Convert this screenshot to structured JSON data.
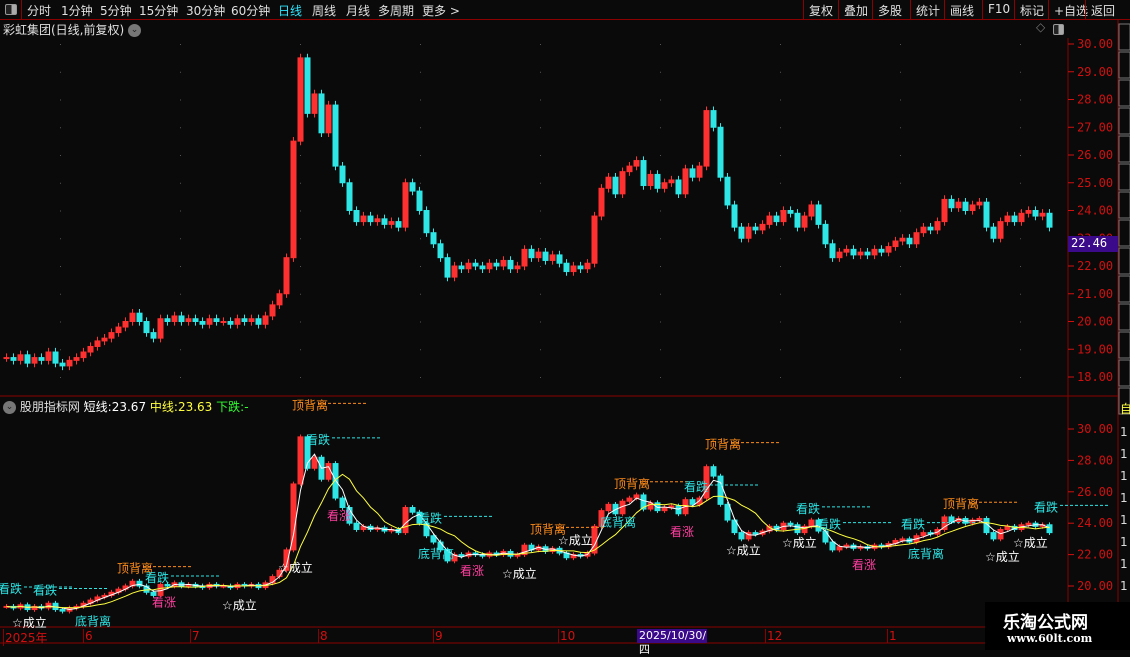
{
  "toolbar": {
    "periods": [
      {
        "label": "分时",
        "active": false
      },
      {
        "label": "1分钟",
        "active": false
      },
      {
        "label": "5分钟",
        "active": false
      },
      {
        "label": "15分钟",
        "active": false
      },
      {
        "label": "30分钟",
        "active": false
      },
      {
        "label": "60分钟",
        "active": false
      },
      {
        "label": "日线",
        "active": true
      },
      {
        "label": "周线",
        "active": false
      },
      {
        "label": "月线",
        "active": false
      },
      {
        "label": "多周期",
        "active": false
      },
      {
        "label": "更多 >",
        "active": false
      }
    ],
    "actions": [
      "复权",
      "叠加",
      "多股",
      "统计",
      "画线",
      "F10",
      "标记",
      "+自选",
      "返回"
    ]
  },
  "main": {
    "title": "彩虹集团(日线,前复权)",
    "last_price": "22.46",
    "last_price_bg": "#3a0a8a"
  },
  "indicator": {
    "name": "股朋指标网",
    "short_label": "短线:",
    "short_value": "23.67",
    "mid_label": "中线:",
    "mid_value": "23.63",
    "down_label": "下跌:",
    "down_value": "-",
    "right_tag": "自"
  },
  "watermark": {
    "title": "乐淘公式网",
    "url": "www.60lt.com"
  },
  "date_axis": {
    "labels": [
      "2025年",
      "6",
      "7",
      "8",
      "9",
      "10",
      "12",
      "1"
    ],
    "cursor_date": "2025/10/30/四"
  },
  "chart_data": [
    {
      "type": "candlestick",
      "panel": "main",
      "ylim": [
        17.6,
        30.2
      ],
      "yticks": [
        18,
        19,
        20,
        21,
        22,
        23,
        24,
        25,
        26,
        27,
        28,
        29,
        30
      ],
      "up_color": "#ff3030",
      "down_color": "#2ee6e6",
      "closes": [
        18.7,
        18.6,
        18.8,
        18.5,
        18.7,
        18.6,
        18.9,
        18.5,
        18.4,
        18.6,
        18.7,
        18.9,
        19.1,
        19.3,
        19.4,
        19.6,
        19.8,
        20.0,
        20.3,
        20.0,
        19.6,
        19.4,
        20.1,
        20.0,
        20.2,
        20.0,
        20.1,
        20.0,
        19.9,
        20.1,
        20.0,
        20.0,
        19.9,
        20.1,
        20.0,
        20.1,
        19.9,
        20.2,
        20.6,
        21.0,
        22.3,
        26.5,
        29.5,
        27.5,
        28.2,
        26.8,
        27.8,
        25.6,
        25.0,
        24.0,
        23.6,
        23.8,
        23.6,
        23.7,
        23.5,
        23.6,
        23.4,
        25.0,
        24.7,
        24.0,
        23.2,
        22.8,
        22.3,
        21.6,
        22.0,
        21.9,
        22.1,
        22.0,
        21.9,
        22.1,
        22.0,
        22.2,
        21.9,
        22.0,
        22.6,
        22.3,
        22.5,
        22.2,
        22.4,
        22.1,
        21.8,
        22.0,
        21.9,
        22.1,
        23.8,
        24.8,
        25.2,
        24.6,
        25.4,
        25.6,
        25.8,
        24.9,
        25.3,
        24.8,
        25.0,
        25.1,
        24.6,
        25.5,
        25.2,
        25.6,
        27.6,
        27.0,
        25.2,
        24.2,
        23.4,
        23.0,
        23.4,
        23.3,
        23.5,
        23.8,
        23.6,
        24.0,
        23.9,
        23.4,
        23.8,
        24.2,
        23.5,
        22.8,
        22.3,
        22.5,
        22.6,
        22.4,
        22.5,
        22.4,
        22.6,
        22.5,
        22.7,
        22.9,
        23.0,
        22.8,
        23.2,
        23.4,
        23.3,
        23.6,
        24.4,
        24.1,
        24.3,
        24.0,
        24.2,
        24.3,
        23.4,
        23.0,
        23.6,
        23.8,
        23.6,
        23.9,
        24.0,
        23.8,
        23.9,
        23.4
      ]
    },
    {
      "type": "candlestick+lines",
      "panel": "indicator",
      "ylim": [
        19,
        31
      ],
      "yticks": [
        20,
        22,
        24,
        26,
        28,
        30
      ],
      "short_line_color": "#ffffff",
      "mid_line_color": "#ffff40",
      "annotations": [
        {
          "i": 0,
          "text": "看跌",
          "color": "#2ee6e6"
        },
        {
          "i": 5,
          "text": "看跌",
          "color": "#2ee6e6"
        },
        {
          "i": 2,
          "text": "☆成立",
          "color": "#ffffff",
          "below": true
        },
        {
          "i": 11,
          "text": "底背离",
          "color": "#2ee6e6",
          "below": true
        },
        {
          "i": 17,
          "text": "顶背离",
          "color": "#ff8c1a"
        },
        {
          "i": 21,
          "text": "看跌",
          "color": "#2ee6e6"
        },
        {
          "i": 22,
          "text": "看涨",
          "color": "#ff3fa0",
          "below": true
        },
        {
          "i": 32,
          "text": "☆成立",
          "color": "#ffffff",
          "below": true
        },
        {
          "i": 42,
          "text": "顶背离",
          "color": "#ff8c1a",
          "above": 2
        },
        {
          "i": 44,
          "text": "看跌",
          "color": "#2ee6e6"
        },
        {
          "i": 47,
          "text": "看涨",
          "color": "#ff3fa0",
          "below": true
        },
        {
          "i": 40,
          "text": "☆成立",
          "color": "#ffffff",
          "below": true
        },
        {
          "i": 60,
          "text": "看跌",
          "color": "#2ee6e6"
        },
        {
          "i": 60,
          "text": "底背离",
          "color": "#2ee6e6",
          "below": true
        },
        {
          "i": 66,
          "text": "看涨",
          "color": "#ff3fa0",
          "below": true
        },
        {
          "i": 72,
          "text": "☆成立",
          "color": "#ffffff",
          "below": true
        },
        {
          "i": 76,
          "text": "顶背离",
          "color": "#ff8c1a"
        },
        {
          "i": 80,
          "text": "☆成立",
          "color": "#ffffff"
        },
        {
          "i": 86,
          "text": "底背离",
          "color": "#2ee6e6",
          "below": true
        },
        {
          "i": 88,
          "text": "顶背离",
          "color": "#ff8c1a"
        },
        {
          "i": 98,
          "text": "看跌",
          "color": "#2ee6e6"
        },
        {
          "i": 96,
          "text": "看涨",
          "color": "#ff3fa0",
          "below": true
        },
        {
          "i": 101,
          "text": "顶背离",
          "color": "#ff8c1a",
          "above": 2
        },
        {
          "i": 104,
          "text": "☆成立",
          "color": "#ffffff",
          "below": true
        },
        {
          "i": 114,
          "text": "看跌",
          "color": "#2ee6e6"
        },
        {
          "i": 112,
          "text": "☆成立",
          "color": "#ffffff",
          "below": true
        },
        {
          "i": 117,
          "text": "看跌",
          "color": "#2ee6e6"
        },
        {
          "i": 122,
          "text": "看涨",
          "color": "#ff3fa0",
          "below": true
        },
        {
          "i": 129,
          "text": "看跌",
          "color": "#2ee6e6"
        },
        {
          "i": 130,
          "text": "底背离",
          "color": "#2ee6e6",
          "below": true
        },
        {
          "i": 135,
          "text": "顶背离",
          "color": "#ff8c1a"
        },
        {
          "i": 141,
          "text": "☆成立",
          "color": "#ffffff",
          "below": true
        },
        {
          "i": 145,
          "text": "☆成立",
          "color": "#ffffff",
          "below": true
        },
        {
          "i": 148,
          "text": "看跌",
          "color": "#2ee6e6"
        }
      ]
    }
  ]
}
